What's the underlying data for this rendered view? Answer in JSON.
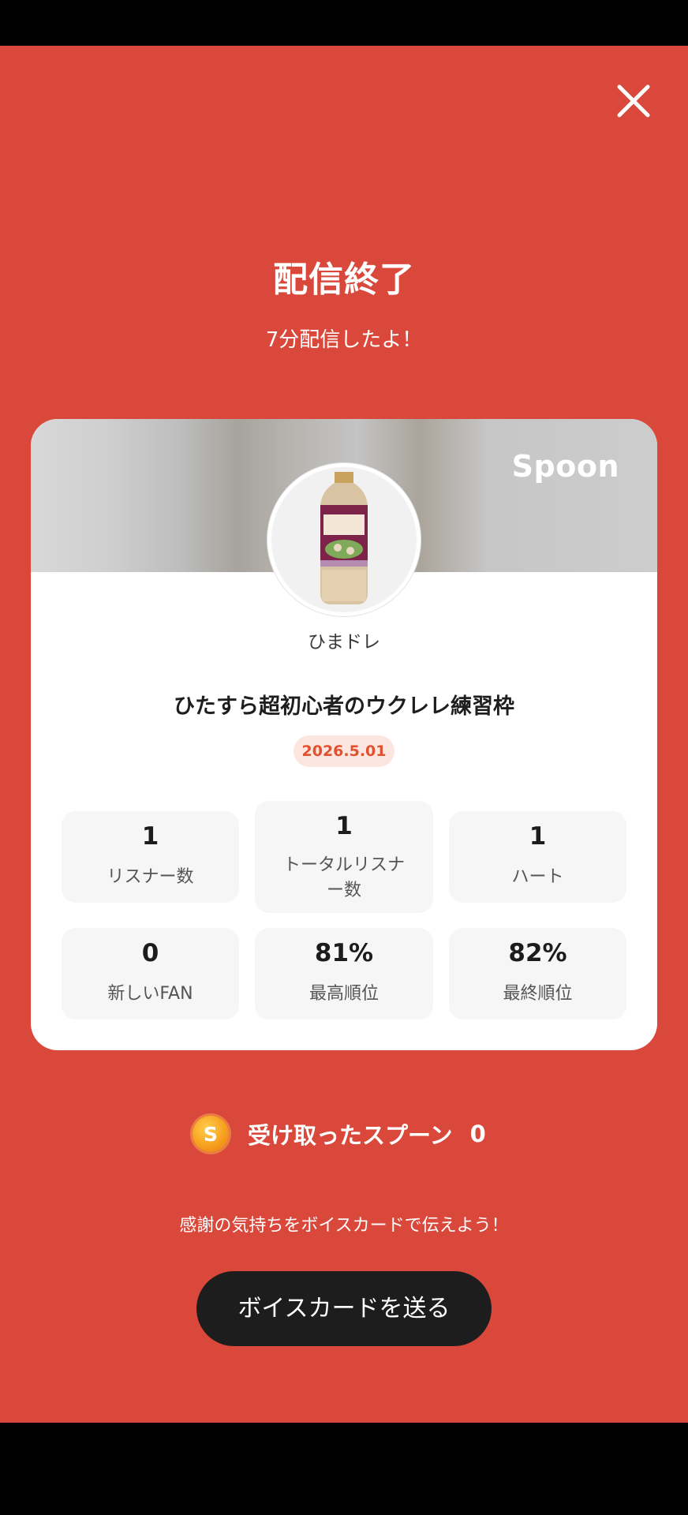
{
  "colors": {
    "background": "#d9483a",
    "card": "#ffffff",
    "accent_badge_text": "#e1502f",
    "button": "#1d1d1d"
  },
  "header": {
    "close_icon": "close-icon"
  },
  "summary": {
    "title": "配信終了",
    "subtitle": "7分配信したよ！"
  },
  "card": {
    "brand": "Spoon",
    "username": "ひまドレ",
    "broadcast_title": "ひたすら超初心者のウクレレ練習枠",
    "date": "2026.5.01",
    "stats": [
      {
        "value": "1",
        "label": "リスナー数"
      },
      {
        "value": "1",
        "label": "トータルリスナー数"
      },
      {
        "value": "1",
        "label": "ハート"
      },
      {
        "value": "0",
        "label": "新しいFAN"
      },
      {
        "value": "81%",
        "label": "最高順位"
      },
      {
        "value": "82%",
        "label": "最終順位"
      }
    ]
  },
  "spoons": {
    "icon": "spoon-coin-icon",
    "icon_letter": "S",
    "label": "受け取ったスプーン",
    "count": "0"
  },
  "footer": {
    "gratitude_text": "感謝の気持ちをボイスカードで伝えよう！",
    "voice_card_button": "ボイスカードを送る"
  }
}
